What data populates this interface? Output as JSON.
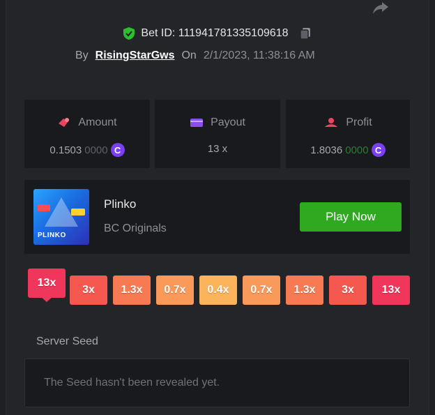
{
  "bet": {
    "id_label": "Bet ID: 1119417813351096​18",
    "by_label": "By",
    "user": "RisingStarGws",
    "on_label": "On",
    "date": "2/1/2023, 11:38:16 AM"
  },
  "stats": {
    "amount": {
      "label": "Amount",
      "value_main": "0.1503",
      "value_dim": "0000",
      "coin": "C"
    },
    "payout": {
      "label": "Payout",
      "value": "13 x"
    },
    "profit": {
      "label": "Profit",
      "value_main": "1.8036",
      "value_dim": "0000",
      "coin": "C"
    }
  },
  "game": {
    "name": "Plinko",
    "provider": "BC Originals",
    "thumb_text": "PLINKO",
    "play_label": "Play Now"
  },
  "multipliers": [
    {
      "label": "13x",
      "color": "#f0365a",
      "hit": true
    },
    {
      "label": "3x",
      "color": "#f5584f",
      "hit": false
    },
    {
      "label": "1.3x",
      "color": "#f77a52",
      "hit": false
    },
    {
      "label": "0.7x",
      "color": "#f9995a",
      "hit": false
    },
    {
      "label": "0.4x",
      "color": "#fbb35c",
      "hit": false
    },
    {
      "label": "0.7x",
      "color": "#f9995a",
      "hit": false
    },
    {
      "label": "1.3x",
      "color": "#f77a52",
      "hit": false
    },
    {
      "label": "3x",
      "color": "#f5584f",
      "hit": false
    },
    {
      "label": "13x",
      "color": "#f0365a",
      "hit": false
    }
  ],
  "seed": {
    "label": "Server Seed",
    "placeholder": "The Seed hasn't been revealed yet."
  },
  "colors": {
    "accent_green": "#2ea920",
    "profit_green": "#28d33a",
    "coin_purple": "#7b3ff2",
    "shield_green": "#2dbe2d"
  }
}
